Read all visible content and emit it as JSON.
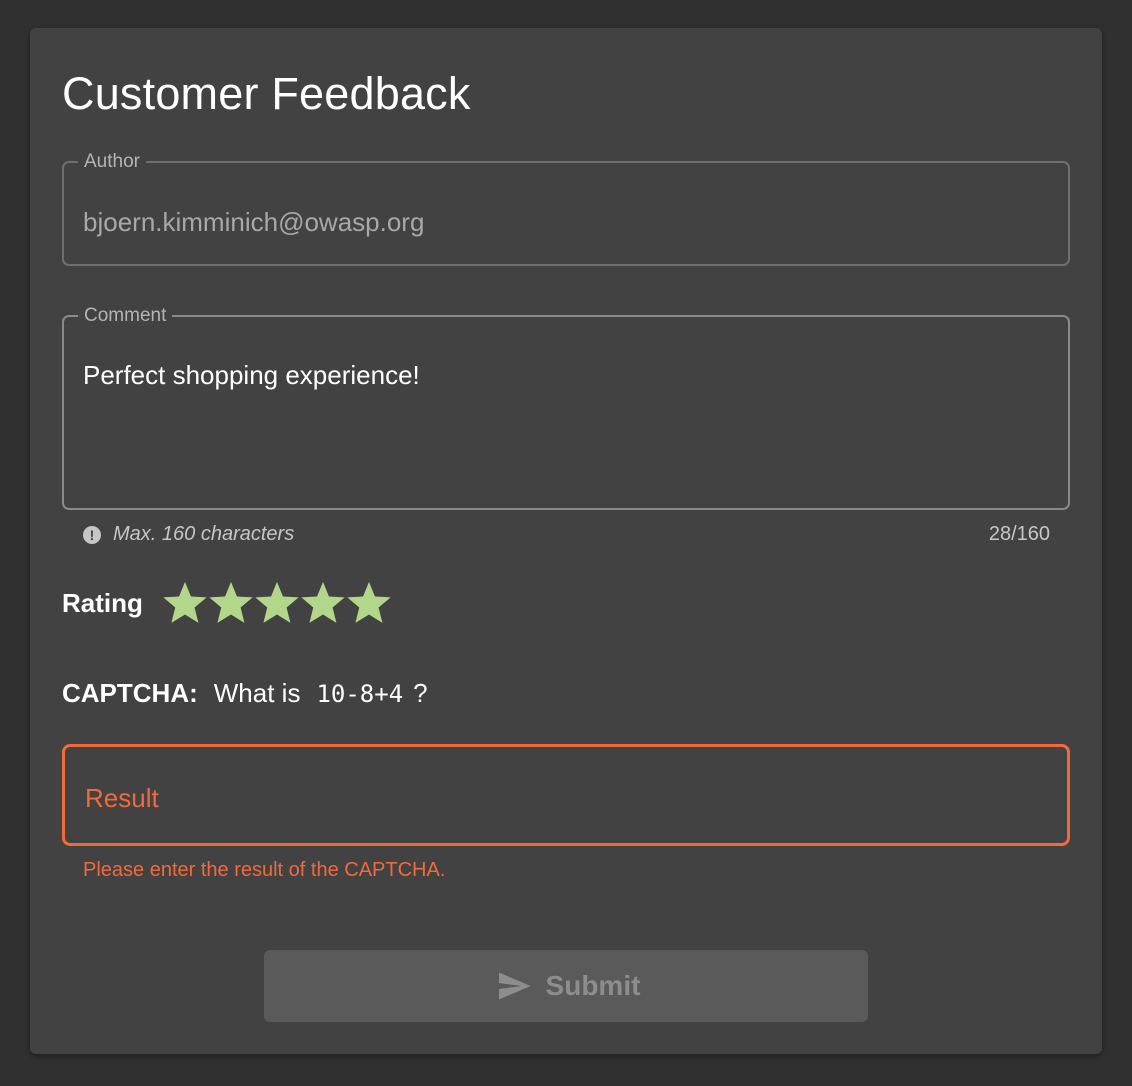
{
  "page": {
    "title": "Customer Feedback"
  },
  "author": {
    "label": "Author",
    "value": "bjoern.kimminich@owasp.org"
  },
  "comment": {
    "label": "Comment",
    "value": "Perfect shopping experience!",
    "hint": "Max. 160 characters",
    "counter": "28/160"
  },
  "rating": {
    "label": "Rating",
    "value": 5,
    "max": 5,
    "star_color": "#b3d78a"
  },
  "captcha": {
    "label": "CAPTCHA:",
    "prefix": "What is",
    "expression": "10-8+4",
    "suffix": "?",
    "result_placeholder": "Result",
    "error": "Please enter the result of the CAPTCHA."
  },
  "submit": {
    "label": "Submit",
    "icon": "send-icon",
    "disabled": true
  },
  "colors": {
    "background": "#303030",
    "card": "#424242",
    "error": "#f06a3c",
    "star": "#b3d78a"
  }
}
